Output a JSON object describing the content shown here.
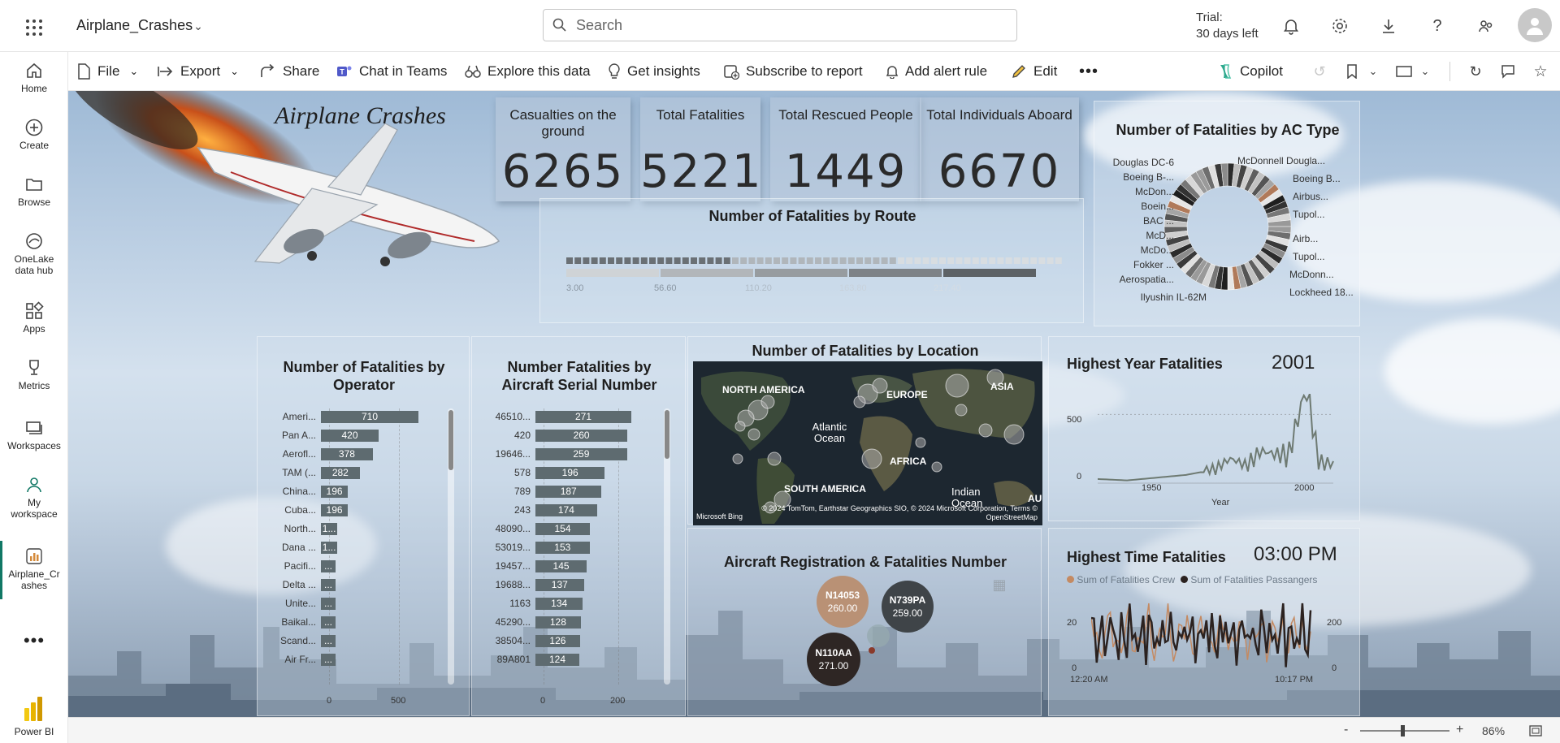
{
  "topbar": {
    "report_name": "Airplane_Crashes",
    "search_placeholder": "Search",
    "trial_line1": "Trial:",
    "trial_line2": "30 days left"
  },
  "nav": {
    "items": [
      {
        "label": "Home"
      },
      {
        "label": "Create"
      },
      {
        "label": "Browse"
      },
      {
        "label": "OneLake data hub"
      },
      {
        "label": "Apps"
      },
      {
        "label": "Metrics"
      },
      {
        "label": "Workspaces"
      },
      {
        "label": "My workspace"
      },
      {
        "label": "Airplane_Crashes"
      },
      {
        "label": "Power BI"
      }
    ]
  },
  "ribbon": {
    "file": "File",
    "export": "Export",
    "share": "Share",
    "chat": "Chat in Teams",
    "explore": "Explore this data",
    "insights": "Get insights",
    "subscribe": "Subscribe to report",
    "alert": "Add alert rule",
    "edit": "Edit",
    "copilot": "Copilot"
  },
  "report": {
    "title": "Airplane Crashes",
    "kpis": [
      {
        "label": "Casualties on the ground",
        "value": "6265"
      },
      {
        "label": "Total Fatalities",
        "value": "5221"
      },
      {
        "label": "Total Rescued People",
        "value": "1449"
      },
      {
        "label": "Total Individuals Aboard",
        "value": "6670"
      }
    ],
    "route": {
      "title": "Number of Fatalities by Route",
      "axis": [
        "3.00",
        "56.60",
        "110.20",
        "163.80",
        "217.40"
      ]
    },
    "donut": {
      "title": "Number of Fatalities by AC Type",
      "left_labels": [
        "Douglas DC-6",
        "Boeing B-...",
        "McDon...",
        "Boein...",
        "BAC ...",
        "McD...",
        "McDo...",
        "Fokker ...",
        "Aerospatia...",
        "Ilyushin IL-62M"
      ],
      "right_labels": [
        "McDonnell Dougla...",
        "Boeing B...",
        "Airbus...",
        "Tupol...",
        "Airb...",
        "Tupol...",
        "McDonn...",
        "Lockheed 18..."
      ]
    },
    "operator": {
      "title": "Number of Fatalities by Operator",
      "axis": [
        "0",
        "500"
      ],
      "rows": [
        {
          "cat": "Ameri...",
          "value": 710,
          "label": "710"
        },
        {
          "cat": "Pan A...",
          "value": 420,
          "label": "420"
        },
        {
          "cat": "Aerofl...",
          "value": 378,
          "label": "378"
        },
        {
          "cat": "TAM (...",
          "value": 282,
          "label": "282"
        },
        {
          "cat": "China...",
          "value": 196,
          "label": "196"
        },
        {
          "cat": "Cuba...",
          "value": 196,
          "label": "196"
        },
        {
          "cat": "North...",
          "value": 120,
          "label": "1..."
        },
        {
          "cat": "Dana ...",
          "value": 120,
          "label": "1..."
        },
        {
          "cat": "Pacifi...",
          "value": 90,
          "label": "..."
        },
        {
          "cat": "Delta ...",
          "value": 90,
          "label": "..."
        },
        {
          "cat": "Unite...",
          "value": 90,
          "label": "..."
        },
        {
          "cat": "Baikal...",
          "value": 90,
          "label": "..."
        },
        {
          "cat": "Scand...",
          "value": 90,
          "label": "..."
        },
        {
          "cat": "Air Fr...",
          "value": 90,
          "label": "..."
        }
      ]
    },
    "serial": {
      "title": "Number Fatalities by Aircraft Serial Number",
      "axis": [
        "0",
        "200"
      ],
      "rows": [
        {
          "cat": "46510...",
          "value": 271,
          "label": "271"
        },
        {
          "cat": "420",
          "value": 260,
          "label": "260"
        },
        {
          "cat": "19646...",
          "value": 259,
          "label": "259"
        },
        {
          "cat": "578",
          "value": 196,
          "label": "196"
        },
        {
          "cat": "789",
          "value": 187,
          "label": "187"
        },
        {
          "cat": "243",
          "value": 174,
          "label": "174"
        },
        {
          "cat": "48090...",
          "value": 154,
          "label": "154"
        },
        {
          "cat": "53019...",
          "value": 153,
          "label": "153"
        },
        {
          "cat": "19457...",
          "value": 145,
          "label": "145"
        },
        {
          "cat": "19688...",
          "value": 137,
          "label": "137"
        },
        {
          "cat": "1163",
          "value": 134,
          "label": "134"
        },
        {
          "cat": "45290...",
          "value": 128,
          "label": "128"
        },
        {
          "cat": "38504...",
          "value": 126,
          "label": "126"
        },
        {
          "cat": "89A801",
          "value": 124,
          "label": "124"
        }
      ]
    },
    "map": {
      "title": "Number of Fatalities by Location",
      "labels": [
        "NORTH AMERICA",
        "EUROPE",
        "ASIA",
        "Atlantic Ocean",
        "AFRICA",
        "SOUTH AMERICA",
        "Indian Ocean",
        "AU"
      ],
      "attribution": "© 2024 TomTom, Earthstar Geographics SIO, © 2024 Microsoft Corporation, Terms © OpenStreetMap",
      "brand": "Microsoft Bing"
    },
    "registration": {
      "title": "Aircraft Registration & Fatalities Number",
      "bubbles": [
        {
          "reg": "N14053",
          "value": "260.00"
        },
        {
          "reg": "N739PA",
          "value": "259.00"
        },
        {
          "reg": "N110AA",
          "value": "271.00"
        }
      ]
    },
    "year": {
      "title": "Highest Year Fatalities",
      "value": "2001",
      "yticks": [
        "500",
        "0"
      ],
      "xticks": [
        "1950",
        "2000"
      ],
      "xlabel": "Year"
    },
    "time": {
      "title": "Highest Time Fatalities",
      "value": "03:00 PM",
      "legend": [
        "Sum of Fatalities Crew",
        "Sum of Fatalities Passangers"
      ],
      "yleft": [
        "20",
        "0"
      ],
      "yright": [
        "200",
        "0"
      ],
      "xticks": [
        "12:20 AM",
        "10:17 PM"
      ]
    }
  },
  "status": {
    "zoom": "86%",
    "zoom_minus": "-",
    "zoom_plus": "+"
  },
  "colors": {
    "accent": "#117865",
    "bar": "#5e6b70",
    "pbi_yellow": "#f2c811",
    "crew": "#c48a62",
    "passengers": "#2b2220"
  },
  "chart_data": [
    {
      "type": "bar",
      "title": "Number of Fatalities by Operator",
      "categories": [
        "Ameri...",
        "Pan A...",
        "Aerofl...",
        "TAM (...",
        "China...",
        "Cuba..."
      ],
      "values": [
        710,
        420,
        378,
        282,
        196,
        196
      ]
    },
    {
      "type": "bar",
      "title": "Number Fatalities by Aircraft Serial Number",
      "categories": [
        "46510...",
        "420",
        "19646...",
        "578",
        "789",
        "243",
        "48090...",
        "53019...",
        "19457...",
        "19688...",
        "1163",
        "45290...",
        "38504...",
        "89A801"
      ],
      "values": [
        271,
        260,
        259,
        196,
        187,
        174,
        154,
        153,
        145,
        137,
        134,
        128,
        126,
        124
      ]
    },
    {
      "type": "line",
      "title": "Highest Year Fatalities",
      "xlabel": "Year",
      "x": [
        1930,
        1940,
        1950,
        1960,
        1970,
        1975,
        1980,
        1985,
        1990,
        1995,
        2001,
        2005,
        2010
      ],
      "y": [
        30,
        20,
        40,
        60,
        100,
        150,
        120,
        200,
        180,
        210,
        600,
        150,
        120
      ],
      "ylim": [
        0,
        650
      ]
    }
  ]
}
